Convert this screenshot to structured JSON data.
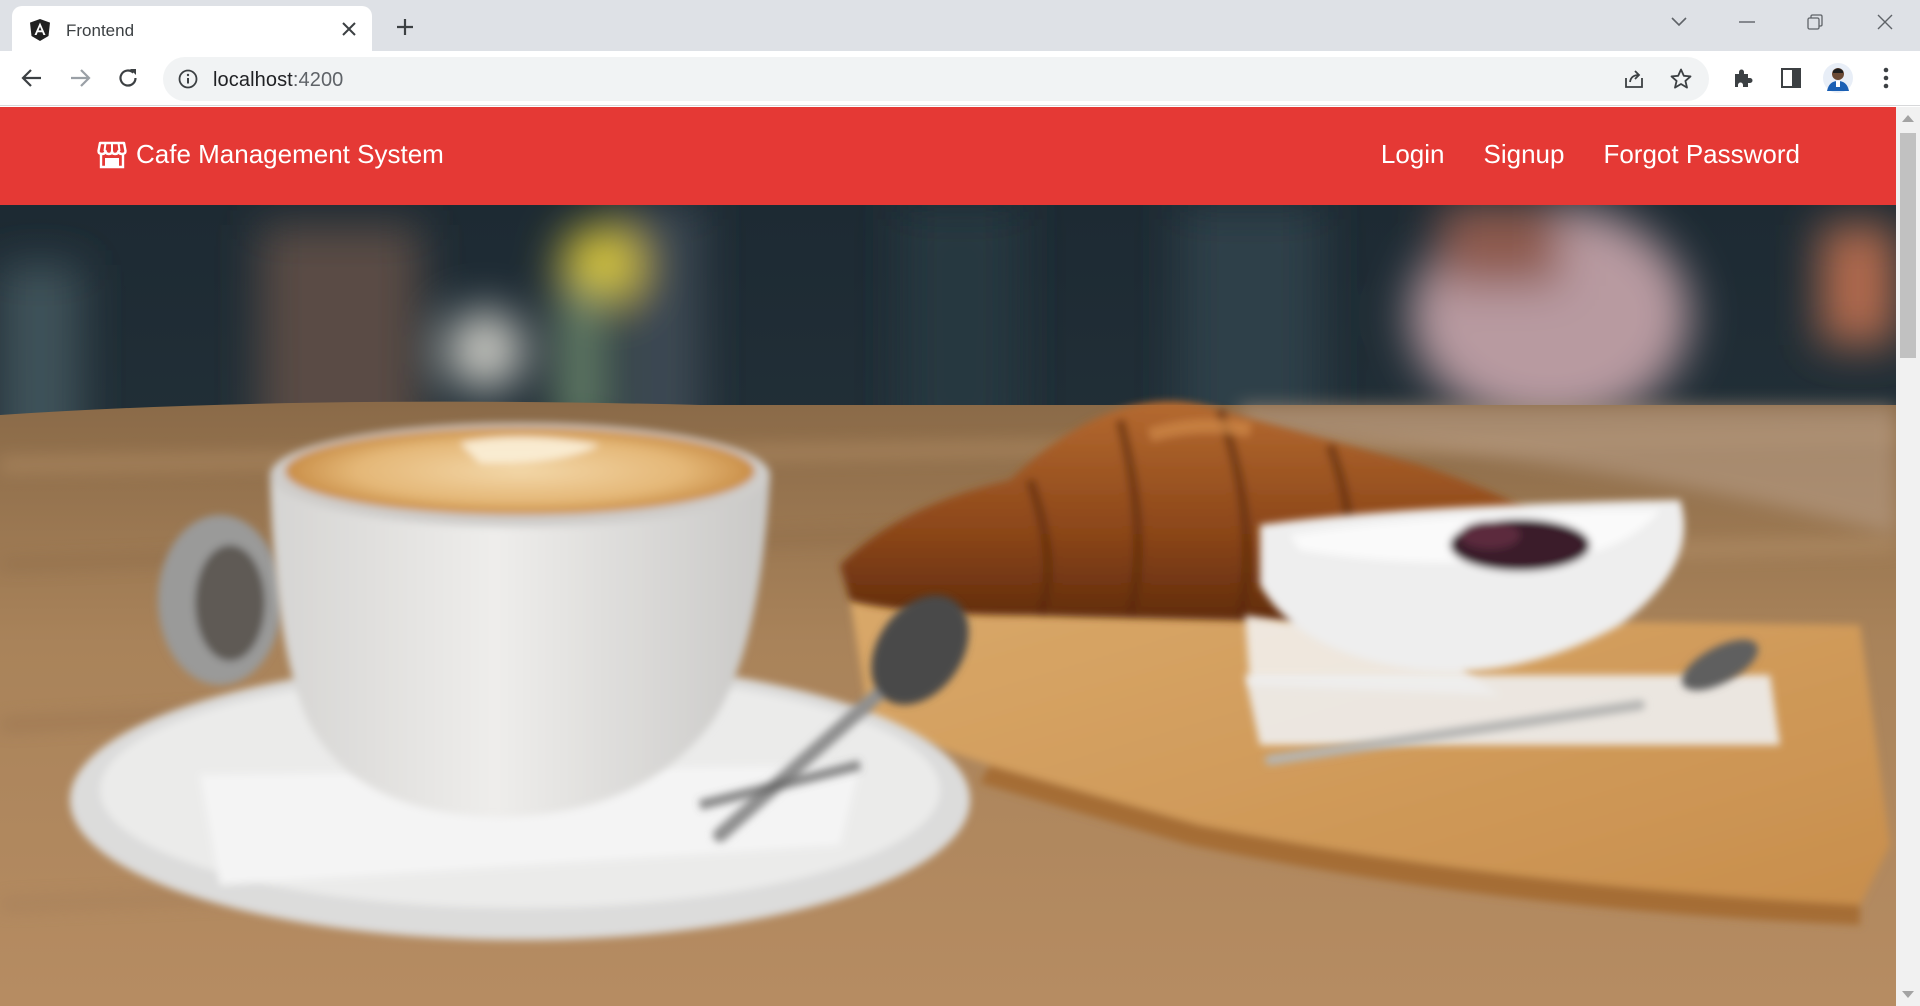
{
  "browser": {
    "tab": {
      "title": "Frontend",
      "favicon": "angular-logo-icon"
    },
    "address": {
      "host": "localhost",
      "port": ":4200"
    },
    "icons": [
      "back-icon",
      "forward-icon",
      "reload-icon",
      "info-icon",
      "share-icon",
      "star-icon",
      "extensions-icon",
      "side-panel-icon",
      "profile-avatar",
      "menu-icon"
    ]
  },
  "app": {
    "brand": {
      "name": "Cafe Management System",
      "icon": "storefront-icon"
    },
    "nav": [
      {
        "label": "Login"
      },
      {
        "label": "Signup"
      },
      {
        "label": "Forgot Password"
      }
    ],
    "accent": "#e53935",
    "hero": {
      "description_icon": "coffee-and-croissant-photo"
    }
  }
}
